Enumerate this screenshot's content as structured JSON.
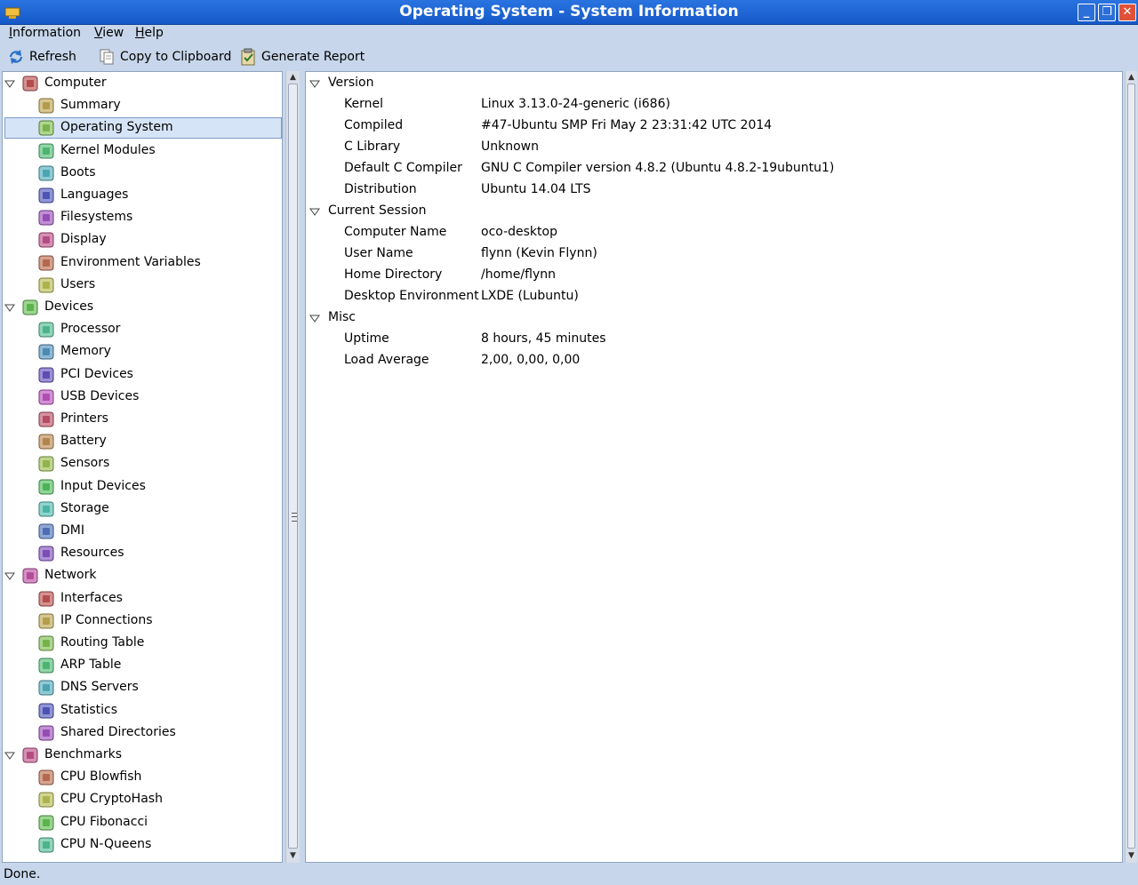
{
  "window": {
    "title": "Operating System - System Information"
  },
  "menu": [
    "Information",
    "View",
    "Help"
  ],
  "toolbar": {
    "refresh": "Refresh",
    "copy": "Copy to Clipboard",
    "report": "Generate Report"
  },
  "tree": [
    {
      "label": "Computer",
      "level": 0,
      "icon": "computer-icon"
    },
    {
      "label": "Summary",
      "level": 1,
      "icon": "info-icon"
    },
    {
      "label": "Operating System",
      "level": 1,
      "icon": "gear-icon",
      "selected": true
    },
    {
      "label": "Kernel Modules",
      "level": 1,
      "icon": "module-icon"
    },
    {
      "label": "Boots",
      "level": 1,
      "icon": "power-icon"
    },
    {
      "label": "Languages",
      "level": 1,
      "icon": "flag-icon"
    },
    {
      "label": "Filesystems",
      "level": 1,
      "icon": "drive-icon"
    },
    {
      "label": "Display",
      "level": 1,
      "icon": "monitor-icon"
    },
    {
      "label": "Environment Variables",
      "level": 1,
      "icon": "terminal-icon"
    },
    {
      "label": "Users",
      "level": 1,
      "icon": "users-icon"
    },
    {
      "label": "Devices",
      "level": 0,
      "icon": "board-icon"
    },
    {
      "label": "Processor",
      "level": 1,
      "icon": "cpu-icon"
    },
    {
      "label": "Memory",
      "level": 1,
      "icon": "memory-icon"
    },
    {
      "label": "PCI Devices",
      "level": 1,
      "icon": "pci-icon"
    },
    {
      "label": "USB Devices",
      "level": 1,
      "icon": "usb-icon"
    },
    {
      "label": "Printers",
      "level": 1,
      "icon": "printer-icon"
    },
    {
      "label": "Battery",
      "level": 1,
      "icon": "battery-icon"
    },
    {
      "label": "Sensors",
      "level": 1,
      "icon": "thermometer-icon"
    },
    {
      "label": "Input Devices",
      "level": 1,
      "icon": "input-icon"
    },
    {
      "label": "Storage",
      "level": 1,
      "icon": "storage-icon"
    },
    {
      "label": "DMI",
      "level": 1,
      "icon": "dmi-icon"
    },
    {
      "label": "Resources",
      "level": 1,
      "icon": "resources-icon"
    },
    {
      "label": "Network",
      "level": 0,
      "icon": "network-icon"
    },
    {
      "label": "Interfaces",
      "level": 1,
      "icon": "interfaces-icon"
    },
    {
      "label": "IP Connections",
      "level": 1,
      "icon": "plug-icon"
    },
    {
      "label": "Routing Table",
      "level": 1,
      "icon": "routing-icon"
    },
    {
      "label": "ARP Table",
      "level": 1,
      "icon": "arp-icon"
    },
    {
      "label": "DNS Servers",
      "level": 1,
      "icon": "globe-icon"
    },
    {
      "label": "Statistics",
      "level": 1,
      "icon": "statistics-icon"
    },
    {
      "label": "Shared Directories",
      "level": 1,
      "icon": "folder-icon"
    },
    {
      "label": "Benchmarks",
      "level": 0,
      "icon": "benchmark-icon"
    },
    {
      "label": "CPU Blowfish",
      "level": 1,
      "icon": "blowfish-icon"
    },
    {
      "label": "CPU CryptoHash",
      "level": 1,
      "icon": "key-icon"
    },
    {
      "label": "CPU Fibonacci",
      "level": 1,
      "icon": "shell-icon"
    },
    {
      "label": "CPU N-Queens",
      "level": 1,
      "icon": "chess-icon"
    }
  ],
  "details": [
    {
      "section": "Version",
      "rows": [
        {
          "key": "Kernel",
          "value": "Linux 3.13.0-24-generic (i686)"
        },
        {
          "key": "Compiled",
          "value": "#47-Ubuntu SMP Fri May 2 23:31:42 UTC 2014"
        },
        {
          "key": "C Library",
          "value": "Unknown"
        },
        {
          "key": "Default C Compiler",
          "value": "GNU C Compiler version 4.8.2 (Ubuntu 4.8.2-19ubuntu1)"
        },
        {
          "key": "Distribution",
          "value": "Ubuntu 14.04 LTS"
        }
      ]
    },
    {
      "section": "Current Session",
      "rows": [
        {
          "key": "Computer Name",
          "value": "oco-desktop"
        },
        {
          "key": "User Name",
          "value": "flynn (Kevin Flynn)"
        },
        {
          "key": "Home Directory",
          "value": "/home/flynn"
        },
        {
          "key": "Desktop Environment",
          "value": "LXDE (Lubuntu)"
        }
      ]
    },
    {
      "section": "Misc",
      "rows": [
        {
          "key": "Uptime",
          "value": "8 hours, 45 minutes"
        },
        {
          "key": "Load Average",
          "value": "2,00, 0,00, 0,00"
        }
      ]
    }
  ],
  "status": "Done."
}
